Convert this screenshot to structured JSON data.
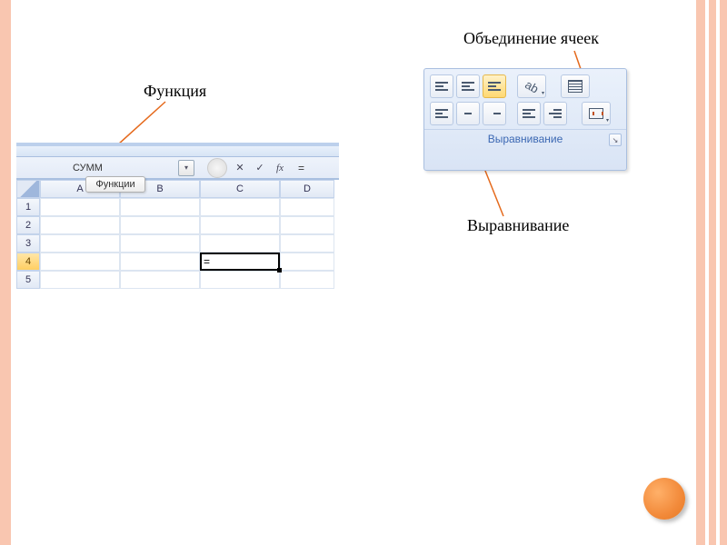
{
  "annotations": {
    "function": "Функция",
    "merge_cells": "Объединение ячеек",
    "alignment": "Выравнивание"
  },
  "excel": {
    "name_box_value": "СУММ",
    "tooltip": "Функции",
    "formula_bar_value": "=",
    "fx_label": "fx",
    "cancel": "✕",
    "enter": "✓",
    "columns": [
      "A",
      "B",
      "C",
      "D"
    ],
    "rows": [
      "1",
      "2",
      "3",
      "4",
      "5"
    ],
    "active_cell_value": "="
  },
  "ribbon": {
    "group_label": "Выравнивание",
    "buttons": {
      "align_top": "align-top",
      "align_middle": "align-middle",
      "align_bottom": "align-bottom",
      "orientation": "orientation",
      "wrap_text": "wrap-text",
      "align_left": "align-left",
      "align_center": "align-center",
      "align_right": "align-right",
      "decrease_indent": "decrease-indent",
      "increase_indent": "increase-indent",
      "merge_center": "merge-center"
    }
  }
}
